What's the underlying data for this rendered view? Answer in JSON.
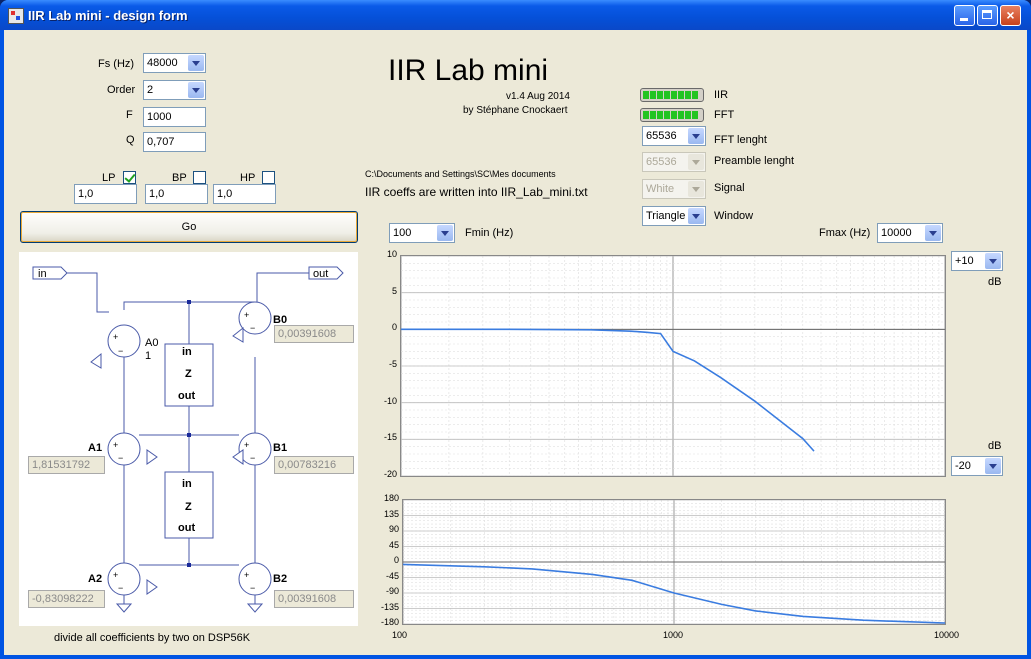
{
  "window": {
    "title": "IIR Lab mini - design form"
  },
  "params": {
    "fs_label": "Fs (Hz)",
    "fs_value": "48000",
    "order_label": "Order",
    "order_value": "2",
    "f_label": "F",
    "f_value": "1000",
    "q_label": "Q",
    "q_value": "0,707"
  },
  "filters": [
    {
      "label": "LP",
      "checked": true,
      "gain": "1,0"
    },
    {
      "label": "BP",
      "checked": false,
      "gain": "1,0"
    },
    {
      "label": "HP",
      "checked": false,
      "gain": "1,0"
    }
  ],
  "go_label": "Go",
  "app": {
    "title": "IIR Lab mini",
    "version": "v1.4 Aug 2014",
    "author": "by Stéphane Cnockaert"
  },
  "output": {
    "path": "C:\\Documents and Settings\\SC\\Mes documents",
    "message": "IIR coeffs are written into IIR_Lab_mini.txt"
  },
  "indicators": {
    "iir_label": "IIR",
    "fft_label": "FFT",
    "led_color": "#22c422"
  },
  "fft": {
    "length_value": "65536",
    "length_label": "FFT lenght",
    "preamble_value": "65536",
    "preamble_label": "Preamble lenght",
    "signal_value": "White",
    "signal_label": "Signal",
    "window_value": "Triangle",
    "window_label": "Window"
  },
  "freq": {
    "fmin_value": "100",
    "fmin_label": "Fmin (Hz)",
    "fmax_label": "Fmax (Hz)",
    "fmax_value": "10000"
  },
  "db": {
    "max_value": "+10",
    "min_value": "-20",
    "unit_top": "dB",
    "unit_bottom": "dB"
  },
  "schematic": {
    "in_label": "in",
    "out_label": "out",
    "a0_label": "A0",
    "a0_value": "1",
    "a1_label": "A1",
    "a1_value": "1,81531792",
    "a2_label": "A2",
    "a2_value": "-0,83098222",
    "b0_label": "B0",
    "b0_value": "0,00391608",
    "b1_label": "B1",
    "b1_value": "0,00783216",
    "b2_label": "B2",
    "b2_value": "0,00391608",
    "z_in": "in",
    "z_mid": "Z",
    "z_out": "out",
    "plus": "+",
    "minus": "−"
  },
  "footnote": "divide all coefficients by two on DSP56K",
  "chart_data": [
    {
      "type": "line",
      "title": "",
      "xscale": "log",
      "xlim": [
        100,
        10000
      ],
      "ylim": [
        -20,
        10
      ],
      "yticks": [
        10,
        5,
        0,
        -5,
        -10,
        -15,
        -20
      ],
      "grid": true,
      "series": [
        {
          "x": [
            100,
            200,
            300,
            500,
            700,
            800,
            900,
            1000,
            1200,
            1500,
            2000,
            2500,
            3000,
            3300
          ],
          "y": [
            0,
            0,
            -0.01,
            -0.06,
            -0.25,
            -0.4,
            -0.58,
            -3.0,
            -4.3,
            -6.6,
            -9.8,
            -12.6,
            -14.9,
            -16.6
          ],
          "color": "#3a7ce0"
        }
      ]
    },
    {
      "type": "line",
      "title": "",
      "xscale": "log",
      "xlim": [
        100,
        10000
      ],
      "ylim": [
        -180,
        180
      ],
      "xticks": [
        100,
        1000,
        10000
      ],
      "yticks": [
        180,
        135,
        90,
        45,
        0,
        -45,
        -90,
        -135,
        -180
      ],
      "grid": true,
      "series": [
        {
          "x": [
            100,
            200,
            300,
            500,
            700,
            1000,
            1500,
            2000,
            3000,
            5000,
            7000,
            10000
          ],
          "y": [
            -7,
            -14,
            -20,
            -36,
            -53,
            -90,
            -123,
            -142,
            -158,
            -169,
            -173,
            -177
          ],
          "color": "#3a7ce0"
        }
      ]
    }
  ]
}
